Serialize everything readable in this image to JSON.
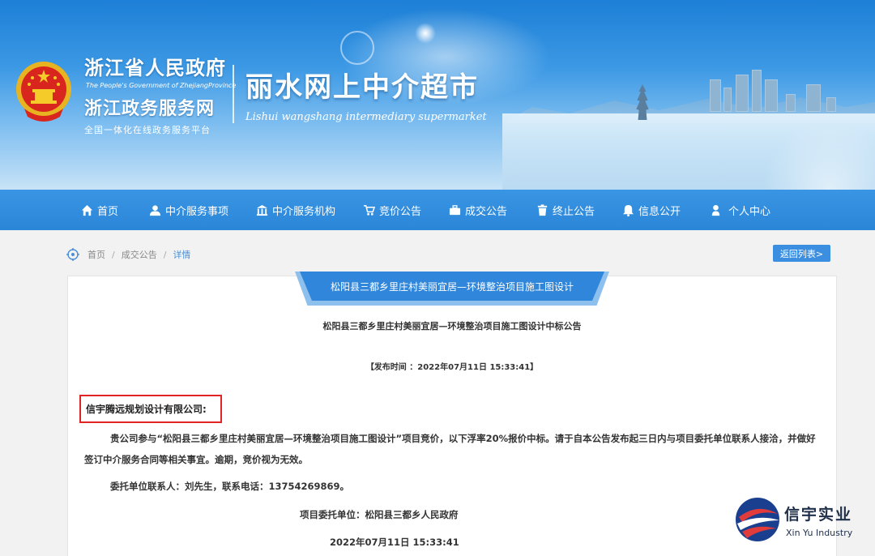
{
  "header": {
    "gov_title": "浙江省人民政府",
    "gov_title_en": "The People's Government of ZhejiangProvince",
    "gov_service": "浙江政务服务网",
    "gov_slogan": "全国一体化在线政务服务平台",
    "site_title": "丽水网上中介超市",
    "site_title_en": "Lishui wangshang intermediary supermarket"
  },
  "nav": {
    "items": [
      {
        "label": "首页",
        "icon": "home-icon"
      },
      {
        "label": "中介服务事项",
        "icon": "user-group-icon"
      },
      {
        "label": "中介服务机构",
        "icon": "building-icon"
      },
      {
        "label": "竞价公告",
        "icon": "cart-icon"
      },
      {
        "label": "成交公告",
        "icon": "briefcase-icon"
      },
      {
        "label": "终止公告",
        "icon": "trash-icon"
      },
      {
        "label": "信息公开",
        "icon": "bell-icon"
      },
      {
        "label": "个人中心",
        "icon": "person-icon"
      }
    ]
  },
  "breadcrumb": {
    "items": [
      "首页",
      "成交公告",
      "详情"
    ],
    "sep": "/"
  },
  "back_button": "返回列表>",
  "article": {
    "ribbon_title": "松阳县三都乡里庄村美丽宜居—环境整治项目施工图设计",
    "title": "松阳县三都乡里庄村美丽宜居—环境整治项目施工图设计中标公告",
    "publish_time": "【发布时间 ：2022年07月11日 15:33:41】",
    "addressee": "信宇腾远规划设计有限公司:",
    "body": "贵公司参与“松阳县三都乡里庄村美丽宜居—环境整治项目施工图设计”项目竞价，以下浮率20%报价中标。请于自本公告发布起三日内与项目委托单位联系人接洽，并做好签订中介服务合同等相关事宜。逾期，竞价视为无效。",
    "contact": "委托单位联系人：刘先生，联系电话：13754269869。",
    "sign_unit": "项目委托单位：松阳县三都乡人民政府",
    "sign_date": "2022年07月11日 15:33:41"
  },
  "watermark": {
    "name_cn": "信宇实业",
    "name_en": "Xin Yu Industry"
  },
  "colors": {
    "nav_bg": "#2b86d8",
    "accent": "#3b8ee0",
    "highlight_box": "#e02424"
  }
}
